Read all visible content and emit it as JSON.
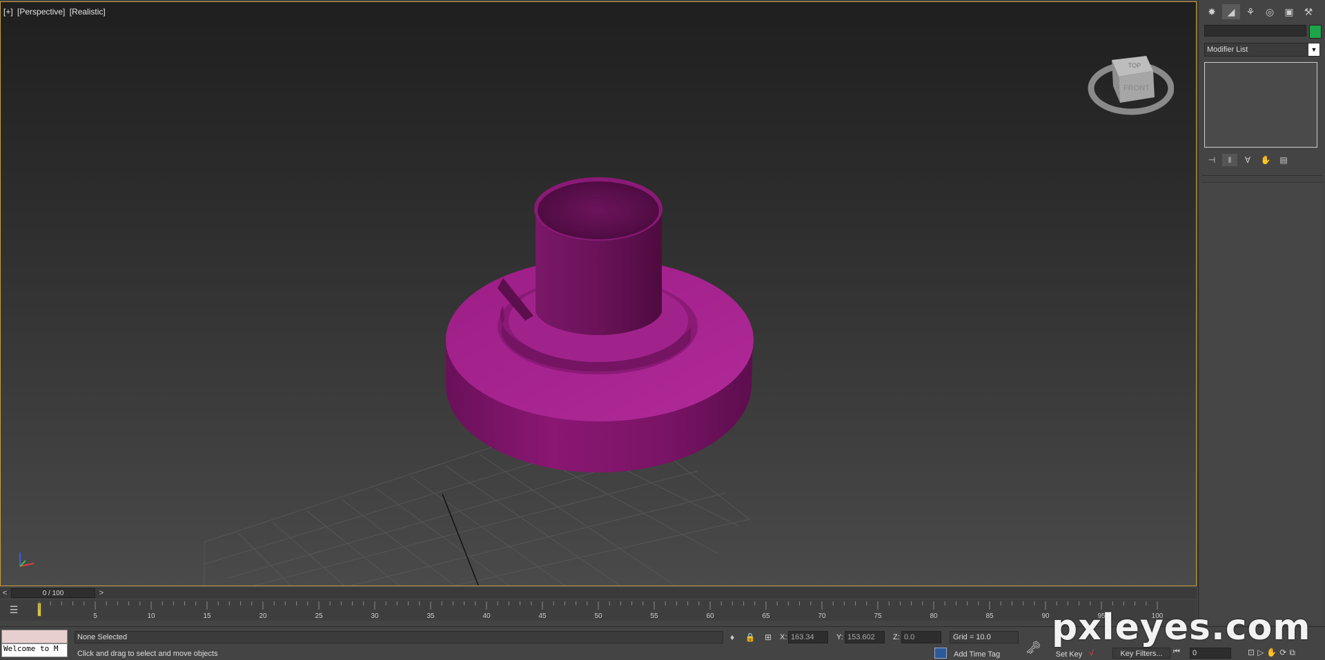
{
  "viewport": {
    "labels": [
      "[+]",
      "[Perspective]",
      "[Realistic]"
    ],
    "viewcube_top": "TOP",
    "viewcube_front": "FRONT"
  },
  "command_panel": {
    "tabs": [
      {
        "icon": "sun-create-icon"
      },
      {
        "icon": "modify-icon"
      },
      {
        "icon": "hierarchy-icon"
      },
      {
        "icon": "motion-icon"
      },
      {
        "icon": "display-icon"
      },
      {
        "icon": "utilities-hammer-icon"
      }
    ],
    "name_value": "",
    "object_color": "#1ea54a",
    "modifier_list": "Modifier List"
  },
  "time_slider": {
    "label": "0 / 100",
    "prev": "<",
    "next": ">"
  },
  "trackbar": {
    "ticks": [
      "5",
      "10",
      "15",
      "20",
      "25",
      "30",
      "35",
      "40",
      "45",
      "50",
      "55",
      "60",
      "65",
      "70",
      "75",
      "80",
      "85",
      "90",
      "95",
      "100"
    ]
  },
  "status": {
    "listener_text": "Welcome to M",
    "selection": "None Selected",
    "prompt": "Click and drag to select and move objects",
    "x_label": "X:",
    "x_value": "163.34",
    "y_label": "Y:",
    "y_value": "153.602",
    "z_label": "Z:",
    "z_value": "0.0",
    "grid": "Grid = 10.0",
    "add_time_tag": "Add Time Tag",
    "set_key": "Set Key",
    "key_filters": "Key Filters...",
    "frame": "0"
  },
  "watermark": "pxleyes.com"
}
